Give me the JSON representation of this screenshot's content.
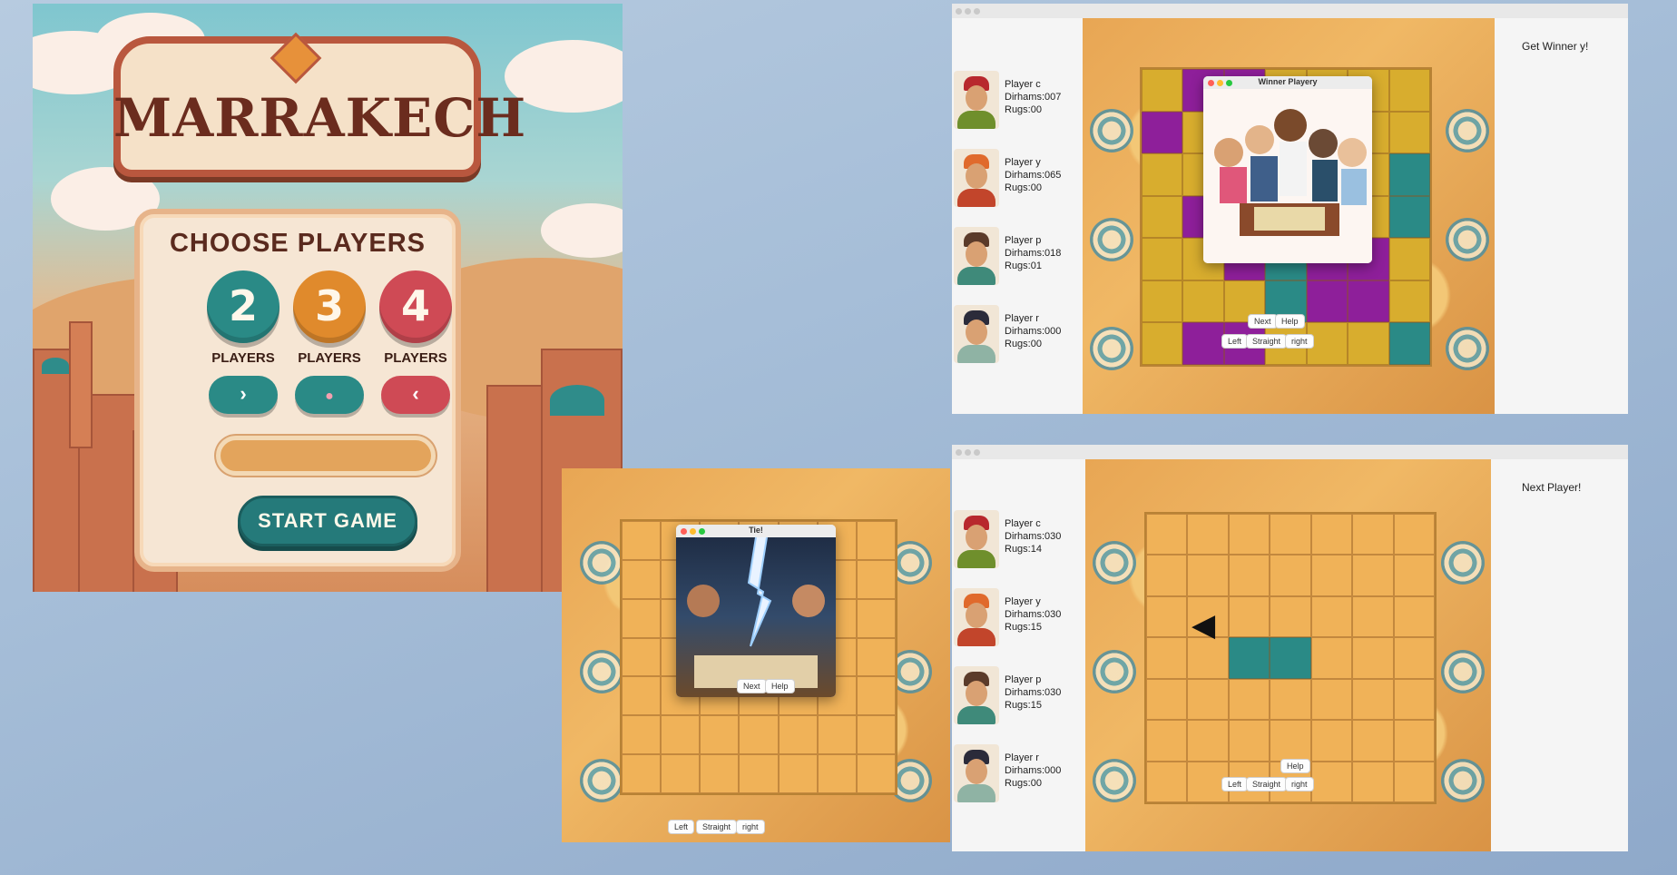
{
  "title_screen": {
    "game_title": "MARRAKECH",
    "choose_title": "CHOOSE PLAYERS",
    "options": [
      {
        "number": "2",
        "label": "PLAYERS",
        "color": "#2a8a86"
      },
      {
        "number": "3",
        "label": "PLAYERS",
        "color": "#e08a2c"
      },
      {
        "number": "4",
        "label": "PLAYERS",
        "color": "#cf4a55"
      }
    ],
    "nav_buttons": [
      {
        "glyph": "›",
        "icon": "chevron-right-icon",
        "color": "#2a8a86"
      },
      {
        "glyph": "●",
        "icon": "dot-icon",
        "color": "#2a8a86"
      },
      {
        "glyph": "‹",
        "icon": "chevron-left-icon",
        "color": "#cf4a55"
      }
    ],
    "start_label": "START GAME"
  },
  "tie_window": {
    "popup_title": "Tie!",
    "buttons": {
      "next": "Next",
      "help": "Help",
      "left": "Left",
      "straight": "Straight",
      "right": "right"
    }
  },
  "winner_window": {
    "side_label": "Get Winner y!",
    "popup_title": "Winner Playery",
    "players": [
      {
        "name": "Player c",
        "dirhams": "Dirhams:007",
        "rugs": "Rugs:00",
        "color": "#b8282d"
      },
      {
        "name": "Player y",
        "dirhams": "Dirhams:065",
        "rugs": "Rugs:00",
        "color": "#e06a2c"
      },
      {
        "name": "Player p",
        "dirhams": "Dirhams:018",
        "rugs": "Rugs:01",
        "color": "#5b3b2a"
      },
      {
        "name": "Player r",
        "dirhams": "Dirhams:000",
        "rugs": "Rugs:00",
        "color": "#2b2b3a"
      }
    ],
    "buttons": {
      "next": "Next",
      "help": "Help",
      "left": "Left",
      "straight": "Straight",
      "right": "right"
    },
    "rug_colors": {
      "purple": "#8e1f9a",
      "yellow": "#d8ad2e",
      "teal": "#2a8a86"
    }
  },
  "next_window": {
    "side_label": "Next Player!",
    "players": [
      {
        "name": "Player c",
        "dirhams": "Dirhams:030",
        "rugs": "Rugs:14",
        "color": "#b8282d"
      },
      {
        "name": "Player y",
        "dirhams": "Dirhams:030",
        "rugs": "Rugs:15",
        "color": "#e06a2c"
      },
      {
        "name": "Player p",
        "dirhams": "Dirhams:030",
        "rugs": "Rugs:15",
        "color": "#5b3b2a"
      },
      {
        "name": "Player r",
        "dirhams": "Dirhams:000",
        "rugs": "Rugs:00",
        "color": "#2b2b3a"
      }
    ],
    "buttons": {
      "help": "Help",
      "left": "Left",
      "straight": "Straight",
      "right": "right"
    },
    "pointer_glyph": "◀"
  }
}
